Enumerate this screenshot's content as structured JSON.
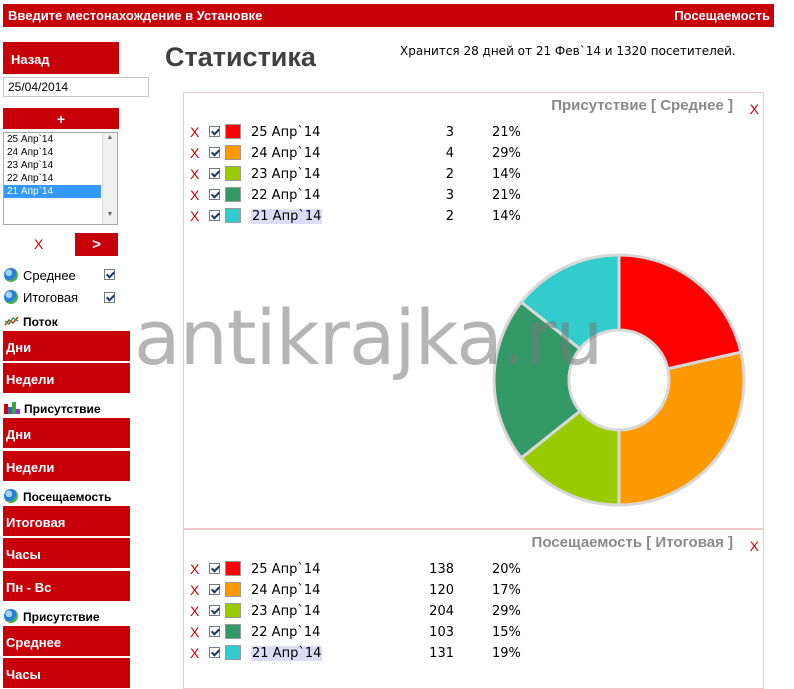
{
  "topbar": {
    "left_title": "Введите местонахождение в Установке",
    "right_title": "Посещаемость"
  },
  "sidebar": {
    "back_label": "Назад",
    "date_value": "25/04/2014",
    "add_label": "+",
    "dates_list": [
      "25 Апр`14",
      "24 Апр`14",
      "23 Апр`14",
      "22 Апр`14",
      "21 Апр`14"
    ],
    "selected_date": "21 Апр`14",
    "remove_label": "X",
    "go_label": ">",
    "options": [
      {
        "label": "Среднее",
        "checked": true
      },
      {
        "label": "Итоговая",
        "checked": true
      }
    ],
    "sections": [
      {
        "title": "Поток",
        "icon": "flow-chart-icon",
        "buttons": [
          "Дни",
          "Недели"
        ]
      },
      {
        "title": "Присутствие",
        "icon": "bar-chart-icon",
        "buttons": [
          "Дни",
          "Недели"
        ]
      },
      {
        "title": "Посещаемость",
        "icon": "globe-icon",
        "buttons": [
          "Итоговая",
          "Часы",
          "Пн - Вс"
        ]
      },
      {
        "title": "Присутствие",
        "icon": "globe-icon",
        "buttons": [
          "Среднее",
          "Часы"
        ]
      }
    ]
  },
  "main": {
    "title": "Статистика",
    "info": "Хранится 28 дней от 21 Фев`14 и 1320 посетителей."
  },
  "colors": {
    "accent": "#c8000a",
    "series": [
      "#ff0000",
      "#ff9900",
      "#99cc00",
      "#339966",
      "#33cccc"
    ]
  },
  "panel1": {
    "title": "Присутствие [ Среднее ]",
    "close": "X",
    "row_x": "X",
    "rows": [
      {
        "label": "25 Апр`14",
        "count": "3",
        "percent": "21%"
      },
      {
        "label": "24 Апр`14",
        "count": "4",
        "percent": "29%"
      },
      {
        "label": "23 Апр`14",
        "count": "2",
        "percent": "14%"
      },
      {
        "label": "22 Апр`14",
        "count": "3",
        "percent": "21%"
      },
      {
        "label": "21 Апр`14",
        "count": "2",
        "percent": "14%"
      }
    ]
  },
  "panel2": {
    "title": "Посещаемость [ Итоговая ]",
    "close": "X",
    "rows": [
      {
        "label": "25 Апр`14",
        "count": "138",
        "percent": "20%"
      },
      {
        "label": "24 Апр`14",
        "count": "120",
        "percent": "17%"
      },
      {
        "label": "23 Апр`14",
        "count": "204",
        "percent": "29%"
      },
      {
        "label": "22 Апр`14",
        "count": "103",
        "percent": "15%"
      },
      {
        "label": "21 Апр`14",
        "count": "131",
        "percent": "19%"
      }
    ]
  },
  "chart_data": {
    "type": "pie",
    "donut": true,
    "categories": [
      "25 Апр`14",
      "24 Апр`14",
      "23 Апр`14",
      "22 Апр`14",
      "21 Апр`14"
    ],
    "values": [
      3,
      4,
      2,
      3,
      2
    ],
    "colors": [
      "#ff0000",
      "#ff9900",
      "#99cc00",
      "#339966",
      "#33cccc"
    ]
  },
  "watermark": "antikrajka.ru"
}
